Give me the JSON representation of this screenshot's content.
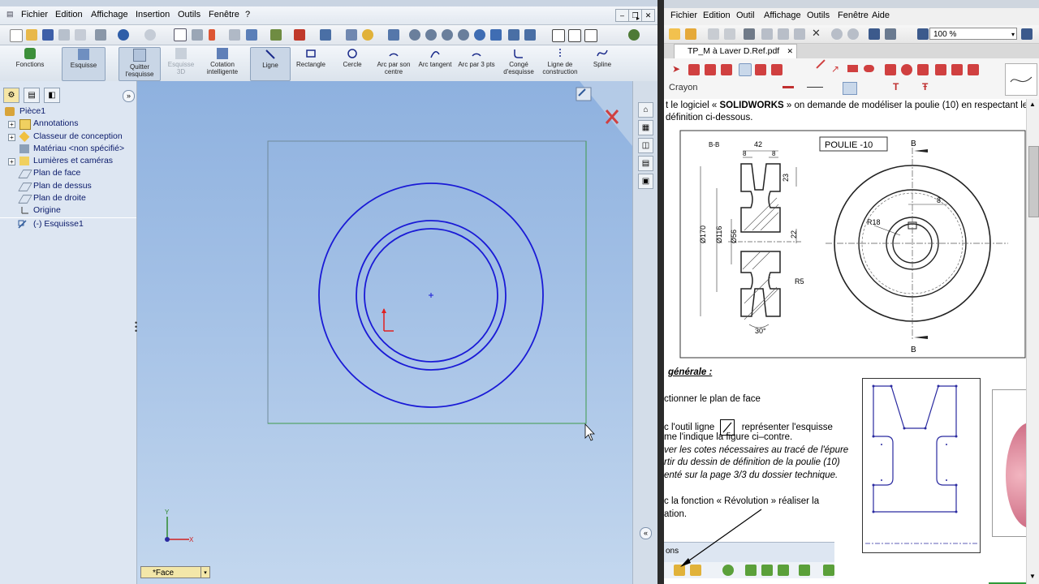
{
  "left_app": {
    "menu": [
      "Fichier",
      "Edition",
      "Affichage",
      "Insertion",
      "Outils",
      "Fenêtre",
      "?"
    ],
    "command_manager": [
      {
        "label": "Fonctions"
      },
      {
        "label": "Esquisse"
      },
      {
        "label": "Quitter l'esquisse"
      },
      {
        "label": "Esquisse 3D"
      },
      {
        "label": "Cotation intelligente"
      },
      {
        "label": "Ligne"
      },
      {
        "label": "Rectangle"
      },
      {
        "label": "Cercle"
      },
      {
        "label": "Arc par son centre"
      },
      {
        "label": "Arc tangent"
      },
      {
        "label": "Arc par 3 pts"
      },
      {
        "label": "Congé d'esquisse"
      },
      {
        "label": "Ligne de construction"
      },
      {
        "label": "Spline"
      }
    ],
    "feature_tree": [
      {
        "label": "Pièce1",
        "icon": "part-icon"
      },
      {
        "label": "Annotations",
        "icon": "annotations-icon"
      },
      {
        "label": "Classeur de conception",
        "icon": "design-binder-icon"
      },
      {
        "label": "Matériau <non spécifié>",
        "icon": "material-icon"
      },
      {
        "label": "Lumières et caméras",
        "icon": "lights-icon"
      },
      {
        "label": "Plan de face",
        "icon": "plane-icon"
      },
      {
        "label": "Plan de dessus",
        "icon": "plane-icon"
      },
      {
        "label": "Plan de droite",
        "icon": "plane-icon"
      },
      {
        "label": "Origine",
        "icon": "origin-icon"
      },
      {
        "label": "(-) Esquisse1",
        "icon": "sketch-icon"
      }
    ],
    "view_orientation": "*Face",
    "colors": {
      "sketch_line": "#1a1ad6",
      "origin": "#e02020"
    }
  },
  "right_app": {
    "menu": [
      "Fichier",
      "Edition",
      "Outil",
      "Affichage",
      "Outils",
      "Fenêtre",
      "Aide"
    ],
    "zoom": "100 %",
    "tab": "TP_M à Laver D.Ref.pdf",
    "tool_label": "Crayon",
    "doc": {
      "intro_line1_pre": "t le logiciel « ",
      "intro_line1_bold": "SOLIDWORKS",
      "intro_line1_post": " » on demande de modéliser la poulie (10) en respectant les",
      "intro_line2": "définition ci-dessous.",
      "drawing": {
        "title": "POULIE -10",
        "section_label": "B-B",
        "dims": [
          "42",
          "8",
          "8",
          "23",
          "Ø170",
          "Ø116",
          "Ø56",
          "22",
          "R5",
          "30°",
          "R18",
          "8",
          "B",
          "B"
        ]
      },
      "heading": "générale :",
      "step1": "ctionner le plan de face",
      "step2a_pre": "c l'outil ligne",
      "step2a_post": "représenter l'esquisse",
      "step2b": "me l'indique la figure ci–contre.",
      "step2c": "ver les cotes nécessaires au tracé de l'épure",
      "step2d": "rtir du dessin de définition de la poulie (10)",
      "step2e": "enté sur la page 3/3 du dossier technique.",
      "step3a": "c la fonction  «  Révolution  »   réaliser la",
      "step3b": "ation.",
      "bottom_tab": "ons"
    }
  }
}
